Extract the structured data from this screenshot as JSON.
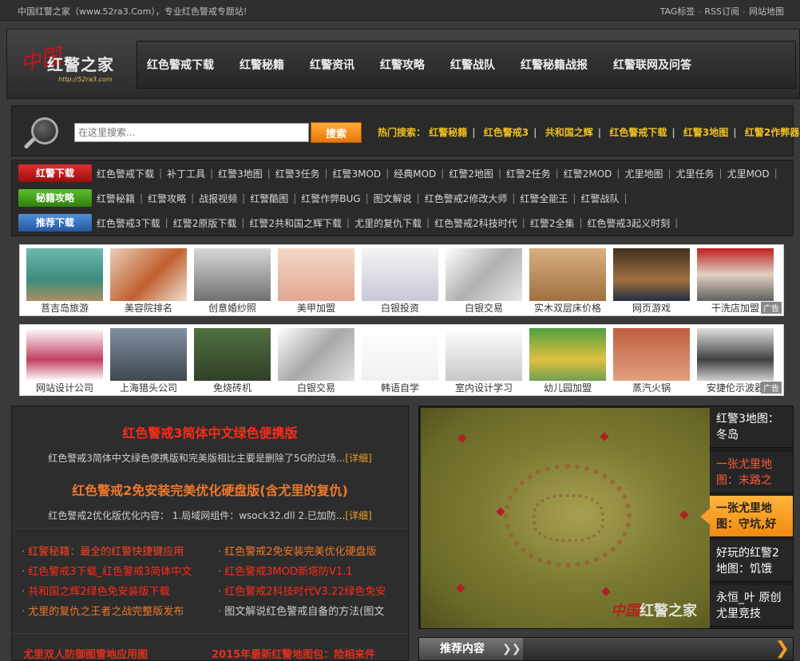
{
  "topbar": {
    "left_text": "中国红警之家（www.52ra3.Com），专业红色警戒专题站!",
    "links": [
      "TAG标签",
      "RSS订阅",
      "网站地图"
    ],
    "sep": "-"
  },
  "logo": {
    "mark": "中国",
    "name": "红警之家",
    "url": "http://52ra3.com"
  },
  "nav": [
    "红色警戒下载",
    "红警秘籍",
    "红警资讯",
    "红警攻略",
    "红警战队",
    "红警秘籍战报",
    "红警联网及问答"
  ],
  "search": {
    "placeholder": "在这里搜索...",
    "button": "搜索",
    "hot_label": "热门搜索：",
    "hot": [
      "红警秘籍",
      "红色警戒3",
      "共和国之辉",
      "红色警戒下载",
      "红警3地图",
      "红警2作弊器"
    ]
  },
  "cat_rows": [
    {
      "label": "红警下载",
      "links": [
        "红色警戒下载",
        "补丁工具",
        "红警3地图",
        "红警3任务",
        "红警3MOD",
        "经典MOD",
        "红警2地图",
        "红警2任务",
        "红警2MOD",
        "尤里地图",
        "尤里任务",
        "尤里MOD"
      ]
    },
    {
      "label": "秘籍攻略",
      "links": [
        "红警秘籍",
        "红警攻略",
        "战报视频",
        "红警酷图",
        "红警作弊BUG",
        "图文解说",
        "红色警戒2修改大师",
        "红警全能王",
        "红警战队"
      ]
    },
    {
      "label": "推荐下载",
      "links": [
        "红色警戒3下载",
        "红警2原版下载",
        "红警2共和国之辉下载",
        "尤里的复仇下载",
        "红色警戒2科技时代",
        "红警2全集",
        "红色警戒3起义时刻"
      ]
    }
  ],
  "ads_row1": [
    "菩吉岛旅游",
    "美容院排名",
    "创意婚纱照",
    "美甲加盟",
    "白银投资",
    "白银交易",
    "实木双层床价格",
    "网页游戏",
    "干洗店加盟"
  ],
  "ads_row2": [
    "网站设计公司",
    "上海猎头公司",
    "免烧砖机",
    "白银交易",
    "韩语自学",
    "室内设计学习",
    "幼儿园加盟",
    "蒸汽火锅",
    "安捷伦示波器"
  ],
  "ad_tag": "广告",
  "featured": [
    {
      "title": "红色警戒3简体中文绿色便携版",
      "desc": "红色警戒3简体中文绿色便携版和完美版相比主要是删除了5G的过场...",
      "more": "[详细]"
    },
    {
      "title": "红色警戒2免安装完美优化硬盘版(含尤里的复仇)",
      "desc": "红色警戒2优化版优化内容： 1.局域网组件：wsock32.dll 2.已加防...",
      "more": "[详细]"
    }
  ],
  "list_left": [
    "红警秘籍：最全的红警快捷键应用",
    "红色警戒3下载_红色警戒3简体中文",
    "共和国之辉2绿色免安装版下载",
    "尤里的复仇之王者之战完整版发布"
  ],
  "list_right": [
    "红色警戒2免安装完美优化硬盘版",
    "红色警戒3MOD新塔防V1.1",
    "红色警戒2科技时代V3.22绿色免安",
    "图文解说红色警戒自备的方法(图文"
  ],
  "bottom_left": "尤里双人防御图雪地应用图",
  "bottom_right": "2015年最新红警地图包：险相来件",
  "slideshow": {
    "watermark_red": "中国",
    "watermark": "红警之家",
    "thumbs": [
      "红警3地图：冬岛",
      "一张尤里地图：末路之",
      "一张尤里地图：守坑,好",
      "好玩的红警2地图：饥饿",
      "永恒_叶 原创尤里竞技"
    ]
  },
  "recommend": {
    "label": "推荐内容"
  }
}
